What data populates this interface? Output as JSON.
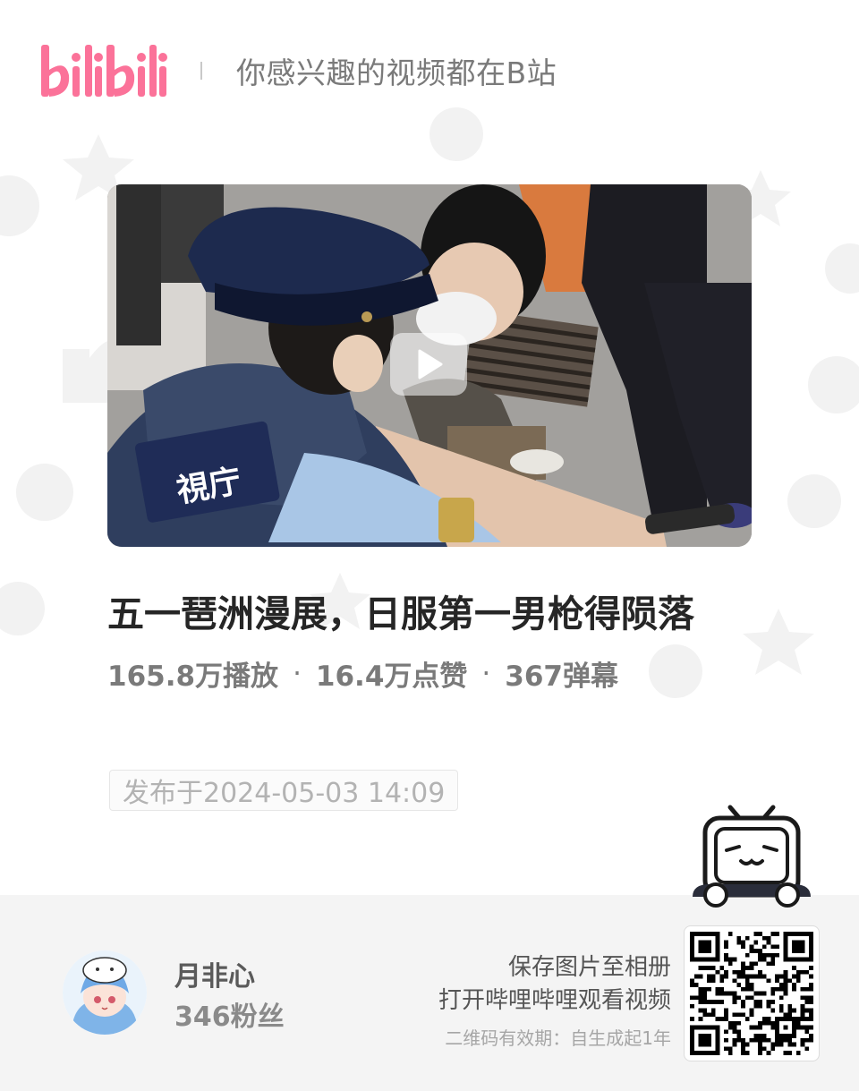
{
  "brand": {
    "logo_text": "bilibili",
    "slogan": "你感兴趣的视频都在B站",
    "accent_color": "#fb7299"
  },
  "video": {
    "cover_badge_text": "視庁",
    "title": "五一琶洲漫展，日服第一男枪得陨落",
    "plays": "165.8万播放",
    "likes": "16.4万点赞",
    "danmaku": "367弹幕",
    "separator": "·",
    "published": "发布于2024-05-03 14:09"
  },
  "uploader": {
    "name": "月非心",
    "fans": "346粉丝"
  },
  "qr": {
    "line1": "保存图片至相册",
    "line2": "打开哔哩哔哩观看视频",
    "validity": "二维码有效期：自生成起1年"
  },
  "icons": {
    "play": "play-icon",
    "mascot": "tv-mascot-icon",
    "qr": "qr-code"
  }
}
